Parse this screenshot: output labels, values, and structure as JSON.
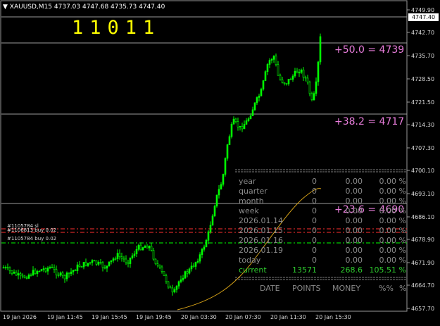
{
  "chart": {
    "symbol": "XAUUSD,M15",
    "ohlc": "4737.03 4747.68 4735.73 4747.40",
    "big_number": "11011",
    "current_price": "4747.40",
    "y_axis": [
      "4749.90",
      "4742.70",
      "4735.70",
      "4728.50",
      "4721.50",
      "4714.30",
      "4707.30",
      "4700.10",
      "4693.10",
      "4686.10",
      "4678.90",
      "4671.90",
      "4664.70",
      "4657.70"
    ],
    "x_axis": [
      "19 Jan 2026",
      "19 Jan 11:45",
      "19 Jan 15:45",
      "19 Jan 19:45",
      "20 Jan 03:30",
      "20 Jan 07:30",
      "20 Jan 11:30",
      "20 Jan 15:30"
    ],
    "fib_levels": [
      {
        "label": "+50.0  = 4739"
      },
      {
        "label": "+38.2  = 4717"
      },
      {
        "label": "+23.6  = 4690"
      }
    ],
    "orders": [
      "#1105784 sl",
      "#1106813 buy 0.02",
      "#1105784 buy 0.02"
    ],
    "colors": {
      "candle": "#00ff00",
      "fib": "#e87ddb",
      "equity": "#d4a017",
      "order_red": "#ff3030",
      "order_green": "#00ff00"
    }
  },
  "stats": {
    "rows": [
      {
        "label": "year",
        "points": "0",
        "money": "0.00",
        "pct": "0.00 %"
      },
      {
        "label": "quarter",
        "points": "0",
        "money": "0.00",
        "pct": "0.00 %"
      },
      {
        "label": "month",
        "points": "0",
        "money": "0.00",
        "pct": "0.00 %"
      },
      {
        "label": "week",
        "points": "0",
        "money": "0.00",
        "pct": "0.00 %"
      },
      {
        "label": "2026.01.14",
        "points": "0",
        "money": "0.00",
        "pct": "0.00 %"
      },
      {
        "label": "2026.01.15",
        "points": "0",
        "money": "0.00",
        "pct": "0.00 %"
      },
      {
        "label": "2026.01.16",
        "points": "0",
        "money": "0.00",
        "pct": "0.00 %"
      },
      {
        "label": "2026.01.19",
        "points": "0",
        "money": "0.00",
        "pct": "0.00 %"
      },
      {
        "label": "today",
        "points": "0",
        "money": "0.00",
        "pct": "0.00 %"
      },
      {
        "label": "current",
        "points": "13571",
        "money": "268.6",
        "pct": "105.51 %"
      }
    ],
    "header": {
      "date": "DATE",
      "points": "POINTS",
      "money": "MONEY",
      "pct": "%%",
      "pct2": "%"
    }
  }
}
